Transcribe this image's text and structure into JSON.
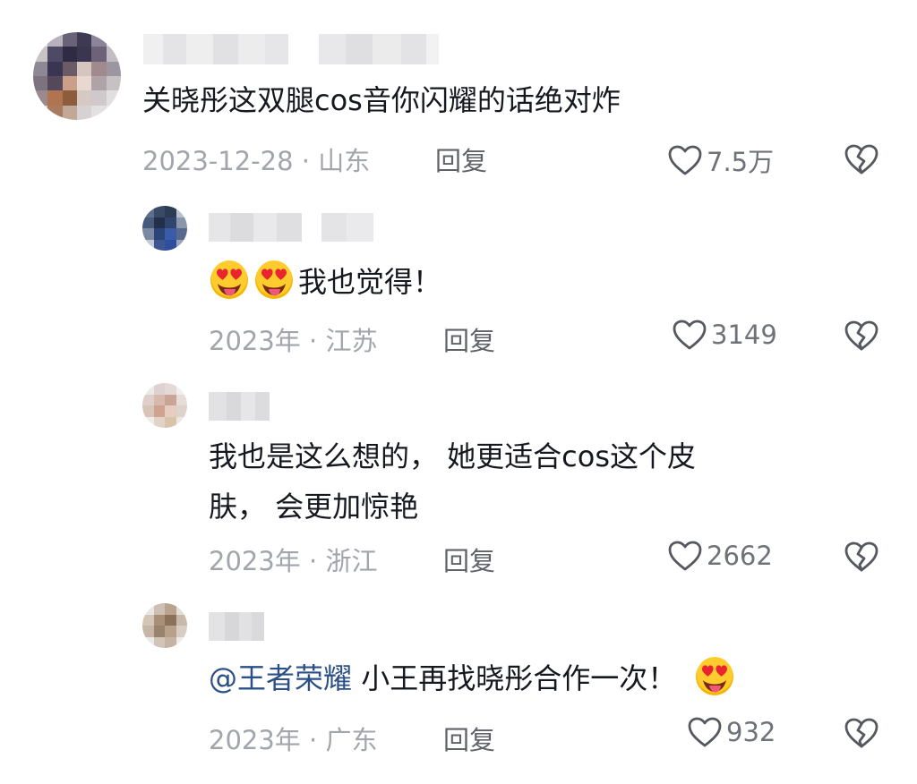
{
  "colors": {
    "text": "#16181f",
    "meta": "#a2a5ab",
    "reply": "#5f6268",
    "mention": "#2b4f86",
    "icon": "#55585e"
  },
  "comments": [
    {
      "text": "关晓彤这双腿cos音你闪耀的话绝对炸",
      "date": "2023-12-28",
      "location": "山东",
      "reply_label": "回复",
      "likes": "7.5万"
    },
    {
      "text": "我也觉得！",
      "emoji_icons": [
        "star-struck-tongue-emoji",
        "star-struck-tongue-emoji"
      ],
      "date": "2023年",
      "location": "江苏",
      "reply_label": "回复",
      "likes": "3149"
    },
    {
      "text_line1": "我也是这么想的， 她更适合cos这个皮",
      "text_line2": "肤， 会更加惊艳",
      "date": "2023年",
      "location": "浙江",
      "reply_label": "回复",
      "likes": "2662"
    },
    {
      "mention": "@王者荣耀",
      "text": " 小王再找晓彤合作一次！",
      "emoji_icons": [
        "star-struck-tongue-emoji"
      ],
      "date": "2023年",
      "location": "广东",
      "reply_label": "回复",
      "likes": "932"
    }
  ],
  "meta_separator": " · ",
  "icons": {
    "like": "heart-outline-icon",
    "dislike": "broken-heart-icon"
  }
}
